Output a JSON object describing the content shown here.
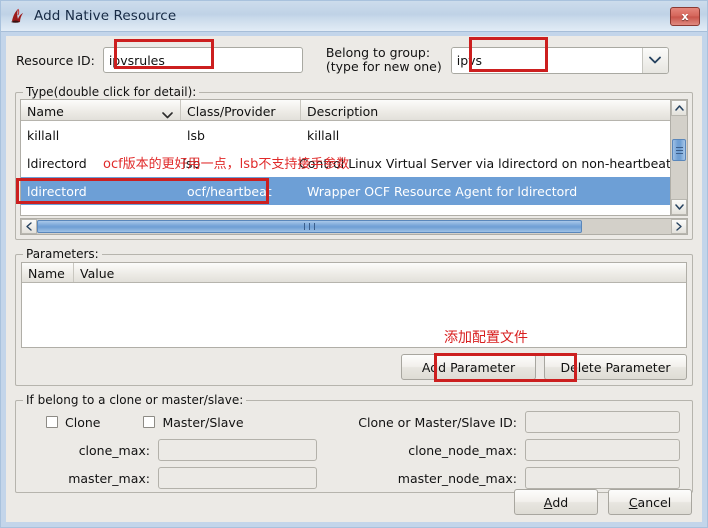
{
  "window": {
    "title": "Add Native Resource",
    "icon": "heartbeat-logo-icon",
    "close_label": "x"
  },
  "form": {
    "resource_id_label": "Resource ID:",
    "resource_id_value": "ipvsrules",
    "group_label_line1": "Belong to group:",
    "group_label_line2": "(type for new one)",
    "group_value": "ipvs"
  },
  "type_section": {
    "title": "Type(double click for detail):",
    "columns": [
      "Name",
      "Class/Provider",
      "Description"
    ],
    "rows": [
      {
        "name": "killall",
        "class": "lsb",
        "description": "killall",
        "selected": false
      },
      {
        "name": "ldirectord",
        "class": "lsb",
        "description": "Control Linux Virtual Server via ldirectord on non-heartbeat s",
        "selected": false
      },
      {
        "name": "ldirectord",
        "class": "ocf/heartbeat",
        "description": "Wrapper OCF Resource Agent for ldirectord",
        "selected": true
      }
    ],
    "annotation": "ocf版本的更好用一点，lsb不支持接手参数"
  },
  "parameters_section": {
    "title": "Parameters:",
    "columns": [
      "Name",
      "Value"
    ],
    "rows": [],
    "annotation": "添加配置文件",
    "add_parameter_label": "Add Parameter",
    "delete_parameter_label": "Delete Parameter"
  },
  "clone_section": {
    "title": "If belong to a clone or master/slave:",
    "clone_label": "Clone",
    "clone_checked": false,
    "master_slave_label": "Master/Slave",
    "master_slave_checked": false,
    "clone_id_label": "Clone or Master/Slave ID:",
    "clone_id_value": "",
    "clone_max_label": "clone_max:",
    "clone_max_value": "",
    "clone_node_max_label": "clone_node_max:",
    "clone_node_max_value": "",
    "master_max_label": "master_max:",
    "master_max_value": "",
    "master_node_max_label": "master_node_max:",
    "master_node_max_value": ""
  },
  "footer": {
    "add_mnemonic": "A",
    "add_rest": "dd",
    "cancel_mnemonic": "C",
    "cancel_rest": "ancel"
  },
  "colors": {
    "titlebar_top": "#cddcec",
    "titlebar_bottom": "#e2ecf6",
    "selection_blue": "#6d9fd6",
    "annotation_red": "#cc1f1f",
    "dialog_bg": "#eceae6",
    "frame_blue": "#c3d5ea"
  }
}
